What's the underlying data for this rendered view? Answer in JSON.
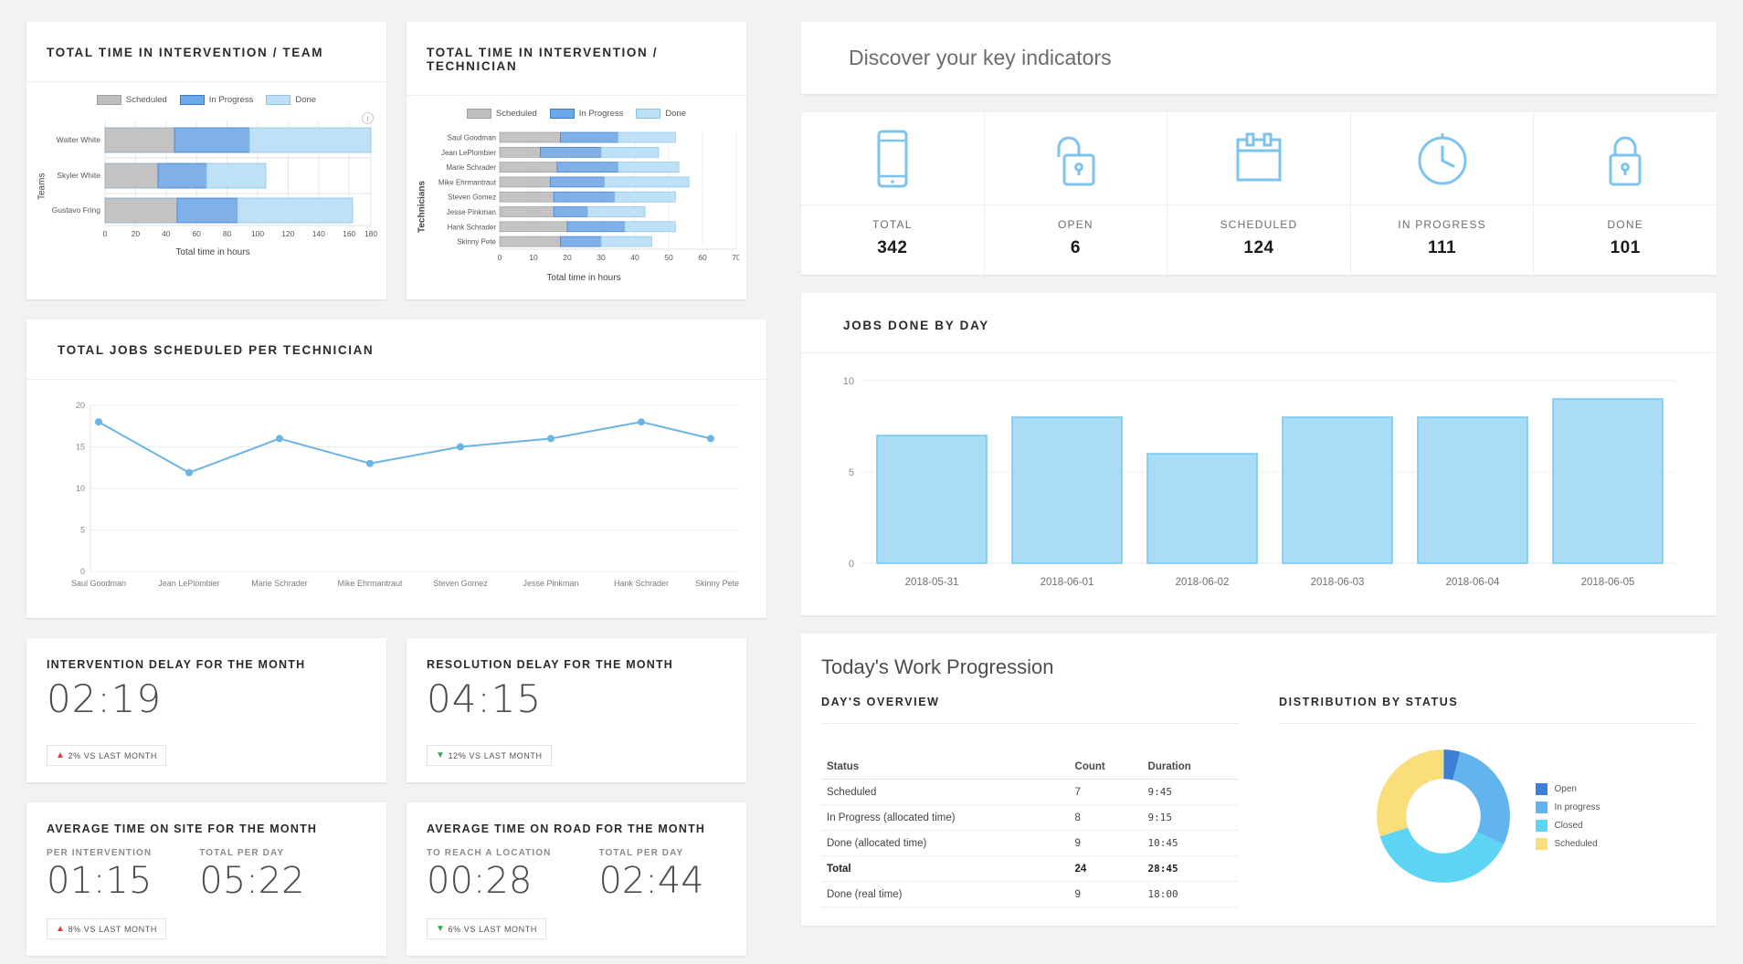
{
  "left": {
    "team_chart": {
      "title": "TOTAL TIME IN INTERVENTION / TEAM",
      "legend": [
        {
          "label": "Scheduled",
          "color": "#bfbfbf"
        },
        {
          "label": "In Progress",
          "color": "#6fa8e8"
        },
        {
          "label": "Done",
          "color": "#bde0f7"
        }
      ],
      "ylabel": "Teams",
      "xlabel": "Total time in hours",
      "info_icon": "info-icon"
    },
    "tech_chart": {
      "title": "TOTAL TIME IN INTERVENTION / TECHNICIAN",
      "legend": [
        {
          "label": "Scheduled",
          "color": "#bfbfbf"
        },
        {
          "label": "In Progress",
          "color": "#6fa8e8"
        },
        {
          "label": "Done",
          "color": "#bde0f7"
        }
      ],
      "ylabel": "Technicians",
      "xlabel": "Total time in hours"
    },
    "line_chart": {
      "title": "TOTAL JOBS SCHEDULED PER TECHNICIAN"
    },
    "kpi_intervention_delay": {
      "title": "INTERVENTION DELAY FOR THE MONTH",
      "value": "02:19",
      "trend_icon": "arrow-up-icon",
      "trend_dir": "up",
      "trend_text": "2% VS LAST MONTH"
    },
    "kpi_resolution_delay": {
      "title": "RESOLUTION DELAY FOR THE MONTH",
      "value": "04:15",
      "trend_icon": "arrow-down-icon",
      "trend_dir": "down",
      "trend_text": "12% VS LAST MONTH"
    },
    "kpi_time_on_site": {
      "title": "AVERAGE TIME ON SITE FOR THE MONTH",
      "col1_label": "PER INTERVENTION",
      "col1_value": "01:15",
      "col2_label": "TOTAL PER DAY",
      "col2_value": "05:22",
      "trend_icon": "arrow-up-icon",
      "trend_dir": "up",
      "trend_text": "8% VS LAST MONTH"
    },
    "kpi_time_on_road": {
      "title": "AVERAGE TIME ON ROAD FOR THE MONTH",
      "col1_label": "TO REACH A LOCATION",
      "col1_value": "00:28",
      "col2_label": "TOTAL PER DAY",
      "col2_value": "02:44",
      "trend_icon": "arrow-down-icon",
      "trend_dir": "down",
      "trend_text": "6% VS LAST MONTH"
    }
  },
  "right": {
    "banner_title": "Discover your key indicators",
    "kpi_tiles": [
      {
        "icon": "mobile-phone-icon",
        "label": "TOTAL",
        "value": "342"
      },
      {
        "icon": "unlocked-padlock-icon",
        "label": "OPEN",
        "value": "6"
      },
      {
        "icon": "calendar-icon",
        "label": "SCHEDULED",
        "value": "124"
      },
      {
        "icon": "stopwatch-clock-icon",
        "label": "IN PROGRESS",
        "value": "111"
      },
      {
        "icon": "locked-padlock-icon",
        "label": "DONE",
        "value": "101"
      }
    ],
    "jobs_card_title": "JOBS DONE BY DAY",
    "progression": {
      "heading": "Today's Work Progression",
      "overview_title": "DAY'S OVERVIEW",
      "distribution_title": "DISTRIBUTION BY STATUS",
      "table": {
        "columns": [
          "Status",
          "Count",
          "Duration"
        ],
        "rows": [
          {
            "status": "Scheduled",
            "count": "7",
            "duration": "9:45",
            "total": false
          },
          {
            "status": "In Progress (allocated time)",
            "count": "8",
            "duration": "9:15",
            "total": false
          },
          {
            "status": "Done (allocated time)",
            "count": "9",
            "duration": "10:45",
            "total": false
          },
          {
            "status": "Total",
            "count": "24",
            "duration": "28:45",
            "total": true
          },
          {
            "status": "Done (real time)",
            "count": "9",
            "duration": "18:00",
            "total": false
          }
        ]
      },
      "donut_legend": [
        {
          "label": "Open",
          "color": "#3e7fd6"
        },
        {
          "label": "In progress",
          "color": "#62b4ef"
        },
        {
          "label": "Closed",
          "color": "#5ed4f4"
        },
        {
          "label": "Scheduled",
          "color": "#fade7a"
        }
      ]
    }
  },
  "chart_data": [
    {
      "type": "bar",
      "orientation": "horizontal",
      "stacked": true,
      "title": "TOTAL TIME IN INTERVENTION / TEAM",
      "xlabel": "Total time in hours",
      "ylabel": "Teams",
      "categories": [
        "Walter White",
        "Skyler White",
        "Gustavo Fring"
      ],
      "series": [
        {
          "name": "Scheduled",
          "color": "#bfbfbf",
          "values": [
            47,
            36,
            49
          ]
        },
        {
          "name": "In Progress",
          "color": "#6fa8e8",
          "values": [
            51,
            33,
            41
          ]
        },
        {
          "name": "Done",
          "color": "#bde0f7",
          "values": [
            82,
            40,
            78
          ]
        }
      ],
      "xticks": [
        0,
        20,
        40,
        60,
        80,
        100,
        120,
        140,
        160,
        180
      ],
      "xlim": [
        0,
        180
      ],
      "grid": true,
      "legend_position": "top"
    },
    {
      "type": "bar",
      "orientation": "horizontal",
      "stacked": true,
      "title": "TOTAL TIME IN INTERVENTION / TECHNICIAN",
      "xlabel": "Total time in hours",
      "ylabel": "Technicians",
      "categories": [
        "Saul Goodman",
        "Jean LePlombier",
        "Marie Schrader",
        "Mike Ehrmantraut",
        "Steven Gomez",
        "Jesse Pinkman",
        "Hank Schrader",
        "Skinny Pete"
      ],
      "series": [
        {
          "name": "Scheduled",
          "color": "#bfbfbf",
          "values": [
            18,
            12,
            17,
            15,
            16,
            16,
            20,
            18
          ]
        },
        {
          "name": "In Progress",
          "color": "#6fa8e8",
          "values": [
            17,
            18,
            18,
            16,
            18,
            10,
            17,
            12
          ]
        },
        {
          "name": "Done",
          "color": "#bde0f7",
          "values": [
            17,
            17,
            18,
            25,
            18,
            17,
            15,
            15
          ]
        }
      ],
      "xticks": [
        0,
        10,
        20,
        30,
        40,
        50,
        60,
        70
      ],
      "xlim": [
        0,
        70
      ],
      "grid": true,
      "legend_position": "top"
    },
    {
      "type": "line",
      "title": "TOTAL JOBS SCHEDULED PER TECHNICIAN",
      "categories": [
        "Saul Goodman",
        "Jean LePlombier",
        "Marie Schrader",
        "Mike Ehrmantraut",
        "Steven Gomez",
        "Jesse Pinkman",
        "Hank Schrader",
        "Skinny Pete"
      ],
      "values": [
        18,
        12,
        16,
        13,
        15,
        16,
        18,
        16
      ],
      "yticks": [
        0,
        5,
        10,
        15,
        20
      ],
      "ylim": [
        0,
        20
      ],
      "color": "#6cb4e4",
      "xlabel": "",
      "ylabel": "",
      "grid": true
    },
    {
      "type": "bar",
      "orientation": "vertical",
      "title": "JOBS DONE BY DAY",
      "categories": [
        "2018-05-31",
        "2018-06-01",
        "2018-06-02",
        "2018-06-03",
        "2018-06-04",
        "2018-06-05"
      ],
      "values": [
        7,
        8,
        6,
        8,
        8,
        9
      ],
      "yticks": [
        0,
        5,
        10
      ],
      "ylim": [
        0,
        10
      ],
      "color": "#a9dcf5",
      "xlabel": "",
      "ylabel": "",
      "grid": true
    },
    {
      "type": "pie",
      "variant": "donut",
      "title": "DISTRIBUTION BY STATUS",
      "labels": [
        "Open",
        "In progress",
        "Closed",
        "Scheduled"
      ],
      "values": [
        4,
        28,
        38,
        30
      ],
      "colors": [
        "#3e7fd6",
        "#62b4ef",
        "#5ed4f4",
        "#fade7a"
      ],
      "legend_position": "right"
    }
  ]
}
